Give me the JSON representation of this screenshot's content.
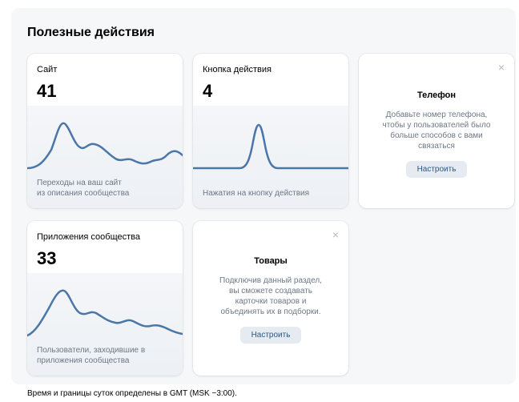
{
  "section": {
    "title": "Полезные действия"
  },
  "cards": {
    "site": {
      "label": "Сайт",
      "value": "41",
      "description": "Переходы на ваш сайт\nиз описания сообщества"
    },
    "action_button": {
      "label": "Кнопка действия",
      "value": "4",
      "description": "Нажатия на кнопку действия"
    },
    "apps": {
      "label": "Приложения сообщества",
      "value": "33",
      "description": "Пользователи, заходившие в\nприложения сообщества"
    }
  },
  "promos": {
    "phone": {
      "close_icon": "×",
      "title": "Телефон",
      "text": "Добавьте номер телефона,\nчтобы у пользователей было\nбольше способов с вами\nсвязаться",
      "button": "Настроить"
    },
    "goods": {
      "close_icon": "×",
      "title": "Товары",
      "text": "Подключив данный раздел,\nвы сможете создавать\nкарточки товаров и\nобъединять их в подборки.",
      "button": "Настроить"
    }
  },
  "footer": {
    "text": "Время и границы суток определены в GMT (MSK −3:00)."
  },
  "colors": {
    "sparkline": "#4a76a8",
    "button_text": "#2a5885",
    "button_bg": "#e5ebf1"
  },
  "icons": {
    "close": "close-icon"
  }
}
